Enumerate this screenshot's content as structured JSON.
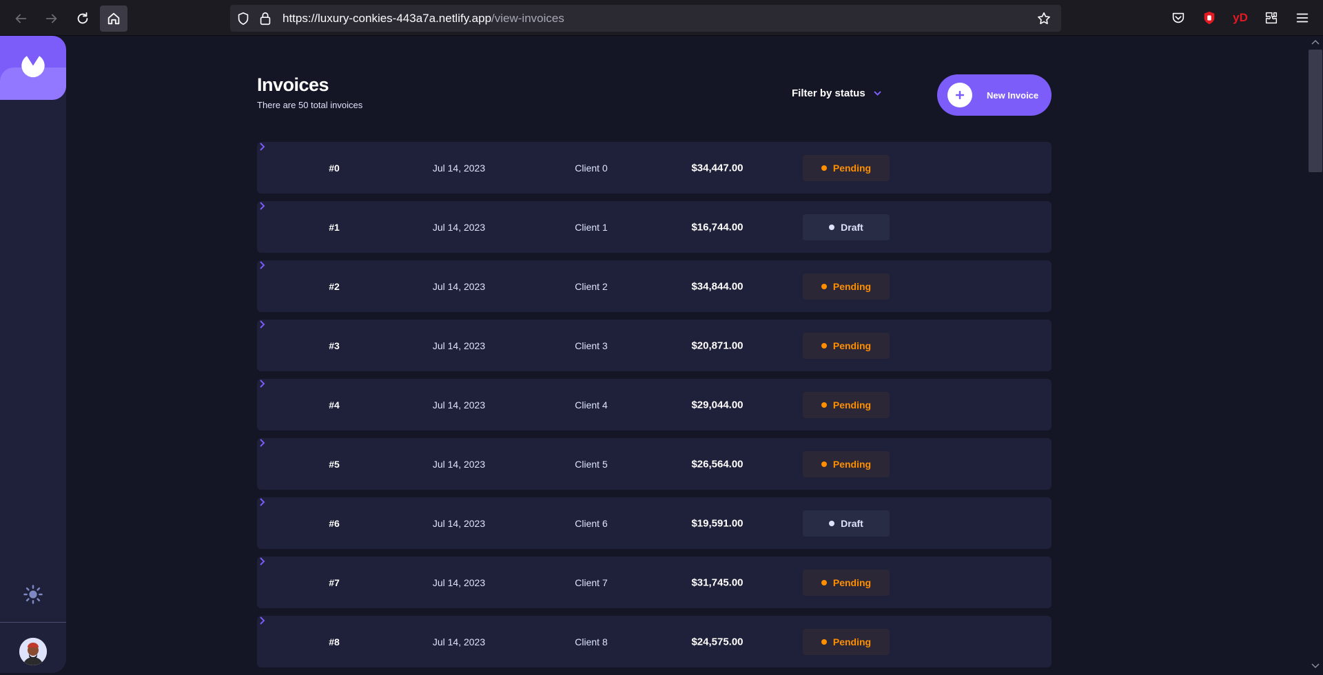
{
  "browser": {
    "url_host": "https://luxury-conkies-443a7a.netlify.app",
    "url_path": "/view-invoices"
  },
  "header": {
    "title": "Invoices",
    "subtitle": "There are 50 total invoices",
    "filter_label": "Filter by status",
    "new_button_label": "New Invoice"
  },
  "invoices": [
    {
      "id": "#0",
      "date": "Jul 14, 2023",
      "client": "Client 0",
      "amount": "$34,447.00",
      "status": "Pending"
    },
    {
      "id": "#1",
      "date": "Jul 14, 2023",
      "client": "Client 1",
      "amount": "$16,744.00",
      "status": "Draft"
    },
    {
      "id": "#2",
      "date": "Jul 14, 2023",
      "client": "Client 2",
      "amount": "$34,844.00",
      "status": "Pending"
    },
    {
      "id": "#3",
      "date": "Jul 14, 2023",
      "client": "Client 3",
      "amount": "$20,871.00",
      "status": "Pending"
    },
    {
      "id": "#4",
      "date": "Jul 14, 2023",
      "client": "Client 4",
      "amount": "$29,044.00",
      "status": "Pending"
    },
    {
      "id": "#5",
      "date": "Jul 14, 2023",
      "client": "Client 5",
      "amount": "$26,564.00",
      "status": "Pending"
    },
    {
      "id": "#6",
      "date": "Jul 14, 2023",
      "client": "Client 6",
      "amount": "$19,591.00",
      "status": "Draft"
    },
    {
      "id": "#7",
      "date": "Jul 14, 2023",
      "client": "Client 7",
      "amount": "$31,745.00",
      "status": "Pending"
    },
    {
      "id": "#8",
      "date": "Jul 14, 2023",
      "client": "Client 8",
      "amount": "$24,575.00",
      "status": "Pending"
    }
  ],
  "colors": {
    "accent": "#7c5dfa",
    "pending": "#ff8f00",
    "draft": "#dfe3fa",
    "background": "#141625",
    "card": "#1e2139"
  },
  "icons": {
    "browser": [
      "back-arrow-icon",
      "forward-arrow-icon",
      "reload-icon",
      "home-icon",
      "shield-icon",
      "lock-icon",
      "star-icon",
      "pocket-icon",
      "ublock-icon",
      "yd-extension-icon",
      "extensions-icon",
      "menu-icon"
    ],
    "app": [
      "logo-icon",
      "sun-icon",
      "avatar",
      "plus-icon",
      "chevron-down-icon",
      "chevron-right-icon"
    ]
  }
}
